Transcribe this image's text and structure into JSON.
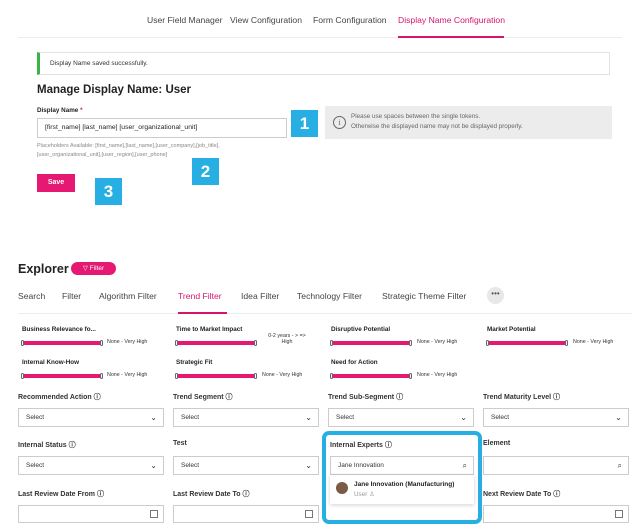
{
  "top_tabs": [
    "User Field Manager",
    "View Configuration",
    "Form Configuration",
    "Display Name Configuration"
  ],
  "success_message": "Display Name saved successfully.",
  "manage_title": "Manage Display Name: User",
  "display_name": {
    "label": "Display Name",
    "required_mark": "*",
    "value": "[first_name] [last_name] [user_organizational_unit]",
    "placeholders_line1": "Placeholders Available: [first_name],[last_name],[user_company],[job_title],",
    "placeholders_line2": "[user_organizational_unit],[user_region],[user_phone]"
  },
  "info": {
    "line1": "Please use spaces between the single tokens.",
    "line2": "Otherwise the displayed name may not be displayed properly."
  },
  "badges": [
    "1",
    "2",
    "3"
  ],
  "save_label": "Save",
  "explorer": {
    "title": "Explorer",
    "filter_label": "Filter",
    "tabs": [
      "Search",
      "Filter",
      "Algorithm Filter",
      "Trend Filter",
      "Idea Filter",
      "Technology Filter",
      "Strategic Theme Filter"
    ],
    "more_label": "•••",
    "sliders": [
      {
        "label": "Business Relevance fo...",
        "value": "None - Very High"
      },
      {
        "label": "Time to Market Impact",
        "value_line1": "0-2 years - > =>",
        "value_line2": "High"
      },
      {
        "label": "Disruptive Potential",
        "value": "None - Very High"
      },
      {
        "label": "Market Potential",
        "value": "None - Very High"
      },
      {
        "label": "Internal Know-How",
        "value": "None - Very High"
      },
      {
        "label": "Strategic Fit",
        "value": "None - Very High"
      },
      {
        "label": "Need for Action",
        "value": "None - Very High"
      }
    ],
    "fields": {
      "recommended_action": {
        "label": "Recommended Action",
        "value": "Select"
      },
      "trend_segment": {
        "label": "Trend Segment",
        "value": "Select"
      },
      "trend_sub_segment": {
        "label": "Trend Sub-Segment",
        "value": "Select"
      },
      "trend_maturity_level": {
        "label": "Trend Maturity Level",
        "value": "Select"
      },
      "internal_status": {
        "label": "Internal Status",
        "value": "Select"
      },
      "test": {
        "label": "Test",
        "value": "Select"
      },
      "internal_experts": {
        "label": "Internal Experts",
        "value": "Jane Innovation"
      },
      "element": {
        "label": "Element",
        "value": ""
      },
      "last_review_from": {
        "label": "Last Review Date From"
      },
      "last_review_to": {
        "label": "Last Review Date To"
      },
      "next_review_to": {
        "label": "Next Review Date To"
      }
    },
    "suggestion": {
      "name": "Jane Innovation (Manufacturing)",
      "role": "User"
    }
  },
  "colors": {
    "accent": "#e61972",
    "badge": "#27aee3",
    "success": "#3bb34a"
  }
}
